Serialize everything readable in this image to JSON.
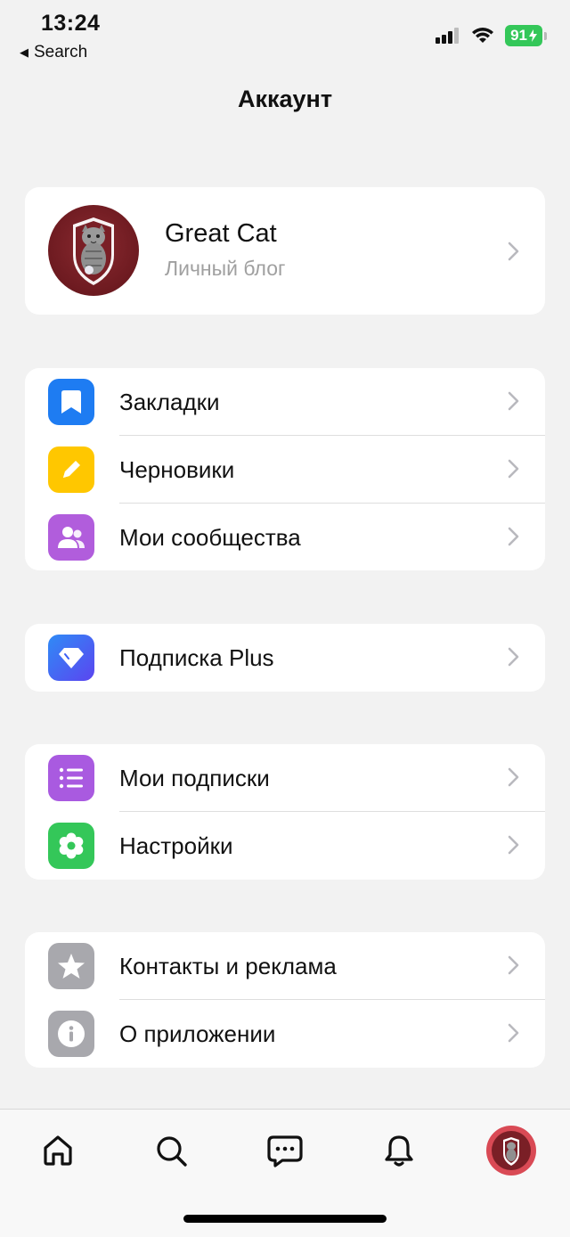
{
  "status_bar": {
    "time": "13:24",
    "back_label": "Search",
    "battery_level": "91",
    "signal_icon": "cellular-signal-icon",
    "wifi_icon": "wifi-icon",
    "battery_icon": "battery-charging-icon"
  },
  "header": {
    "title": "Аккаунт"
  },
  "profile": {
    "name": "Great Cat",
    "subtitle": "Личный блог",
    "avatar_icon": "cat-shield-avatar"
  },
  "menu": {
    "group1": [
      {
        "label": "Закладки",
        "icon": "bookmark-icon",
        "color": "#1e7cf2"
      },
      {
        "label": "Черновики",
        "icon": "pencil-icon",
        "color": "#ffc700"
      },
      {
        "label": "Мои сообщества",
        "icon": "people-icon",
        "color": "#b15ddc"
      }
    ],
    "group2": [
      {
        "label": "Подписка Plus",
        "icon": "diamond-icon",
        "color": "#3b5ff5"
      }
    ],
    "group3": [
      {
        "label": "Мои подписки",
        "icon": "list-icon",
        "color": "#a95ae0"
      },
      {
        "label": "Настройки",
        "icon": "gear-icon",
        "color": "#34c759"
      }
    ],
    "group4": [
      {
        "label": "Контакты и реклама",
        "icon": "star-icon",
        "color": "#a8a8ad"
      },
      {
        "label": "О приложении",
        "icon": "info-icon",
        "color": "#a8a8ad"
      }
    ]
  },
  "tab_bar": {
    "tabs": [
      {
        "icon": "home-icon"
      },
      {
        "icon": "search-icon"
      },
      {
        "icon": "chat-icon"
      },
      {
        "icon": "bell-icon"
      },
      {
        "icon": "profile-avatar-icon"
      }
    ]
  }
}
